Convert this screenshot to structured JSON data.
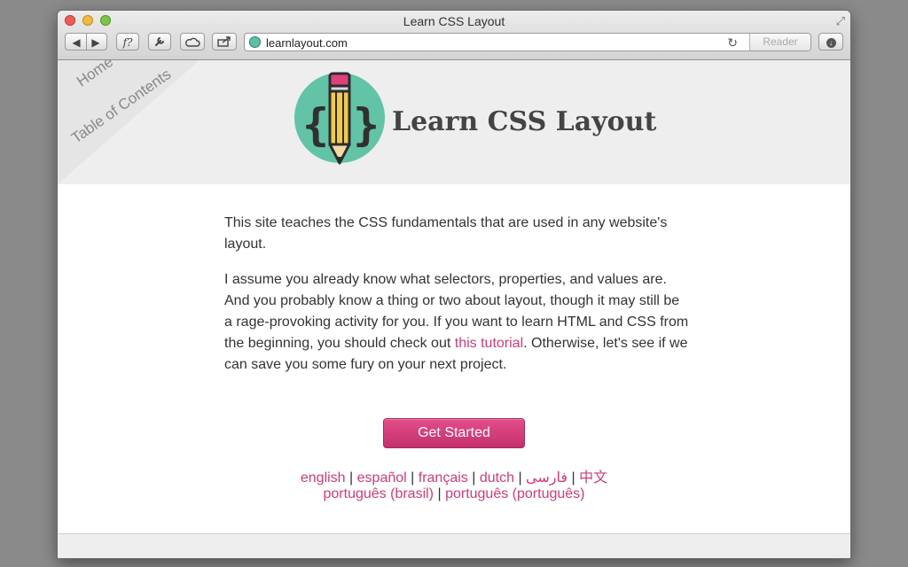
{
  "window": {
    "title": "Learn CSS Layout",
    "nav_back_icon": "◀",
    "nav_forward_icon": "▶",
    "script_btn": "f?",
    "address_url": "learnlayout.com",
    "reader_label": "Reader"
  },
  "corner": {
    "home": "Home",
    "toc": "Table of Contents"
  },
  "header": {
    "title": "Learn CSS Layout"
  },
  "intro": {
    "p1": "This site teaches the CSS fundamentals that are used in any website's layout.",
    "p2_before": "I assume you already know what selectors, properties, and values are. And you probably know a thing or two about layout, though it may still be a rage-provoking activity for you. If you want to learn HTML and CSS from the beginning, you should check out ",
    "p2_link": "this tutorial",
    "p2_after": ". Otherwise, let's see if we can save you some fury on your next project."
  },
  "cta": {
    "label": "Get Started"
  },
  "languages": {
    "row1": [
      "english",
      "español",
      "français",
      "dutch",
      "فارسی",
      "中文"
    ],
    "row2": [
      "português (brasil)",
      "português (português)"
    ],
    "separator": "|"
  },
  "colors": {
    "accent": "#cf3b79",
    "logo_circle": "#62c3a7"
  }
}
